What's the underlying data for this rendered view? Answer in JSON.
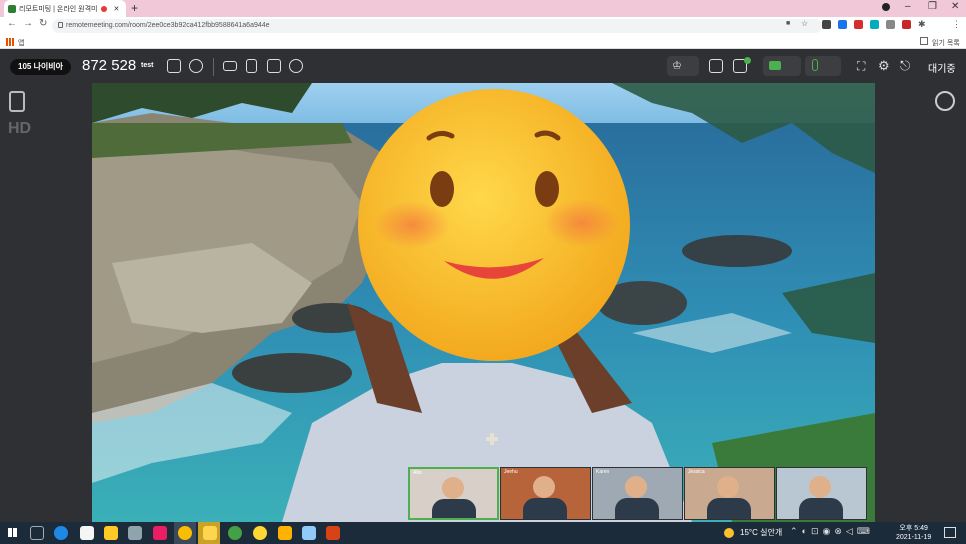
{
  "browser": {
    "tab_title": "리모트미팅 | 온라인 원격미",
    "new_tab": "+",
    "url": "remotemeeting.com/room/2ee0ce3b92ca412fbb9588641a6a944e",
    "bookmark_apps": "앱",
    "bookmark_reading_list": "읽기 목록",
    "window_controls": [
      "–",
      "❐",
      "✕"
    ]
  },
  "toolbar": {
    "room_pill": "105 나이비아",
    "room_number": "872 528",
    "room_tag": "test",
    "wait_label": "대기중"
  },
  "sidebar": {
    "hd_label": "HD"
  },
  "participants": [
    {
      "name": "Alto",
      "color": "#d8d0c8"
    },
    {
      "name": "Jeehu",
      "color": "#b7643a"
    },
    {
      "name": "Karen",
      "color": "#9fa9b3"
    },
    {
      "name": "Jessica",
      "color": "#c9a98f"
    },
    {
      "name": "",
      "color": "#b9c7d3"
    }
  ],
  "taskbar": {
    "weather": "15°C 실안개",
    "time": "오후 5:49",
    "date": "2021-11-19"
  },
  "colors": {
    "sea": "#2f7fae",
    "sky": "#7ec0e6",
    "emoji_face": "#f9c32a",
    "appbar": "#2f3033"
  }
}
